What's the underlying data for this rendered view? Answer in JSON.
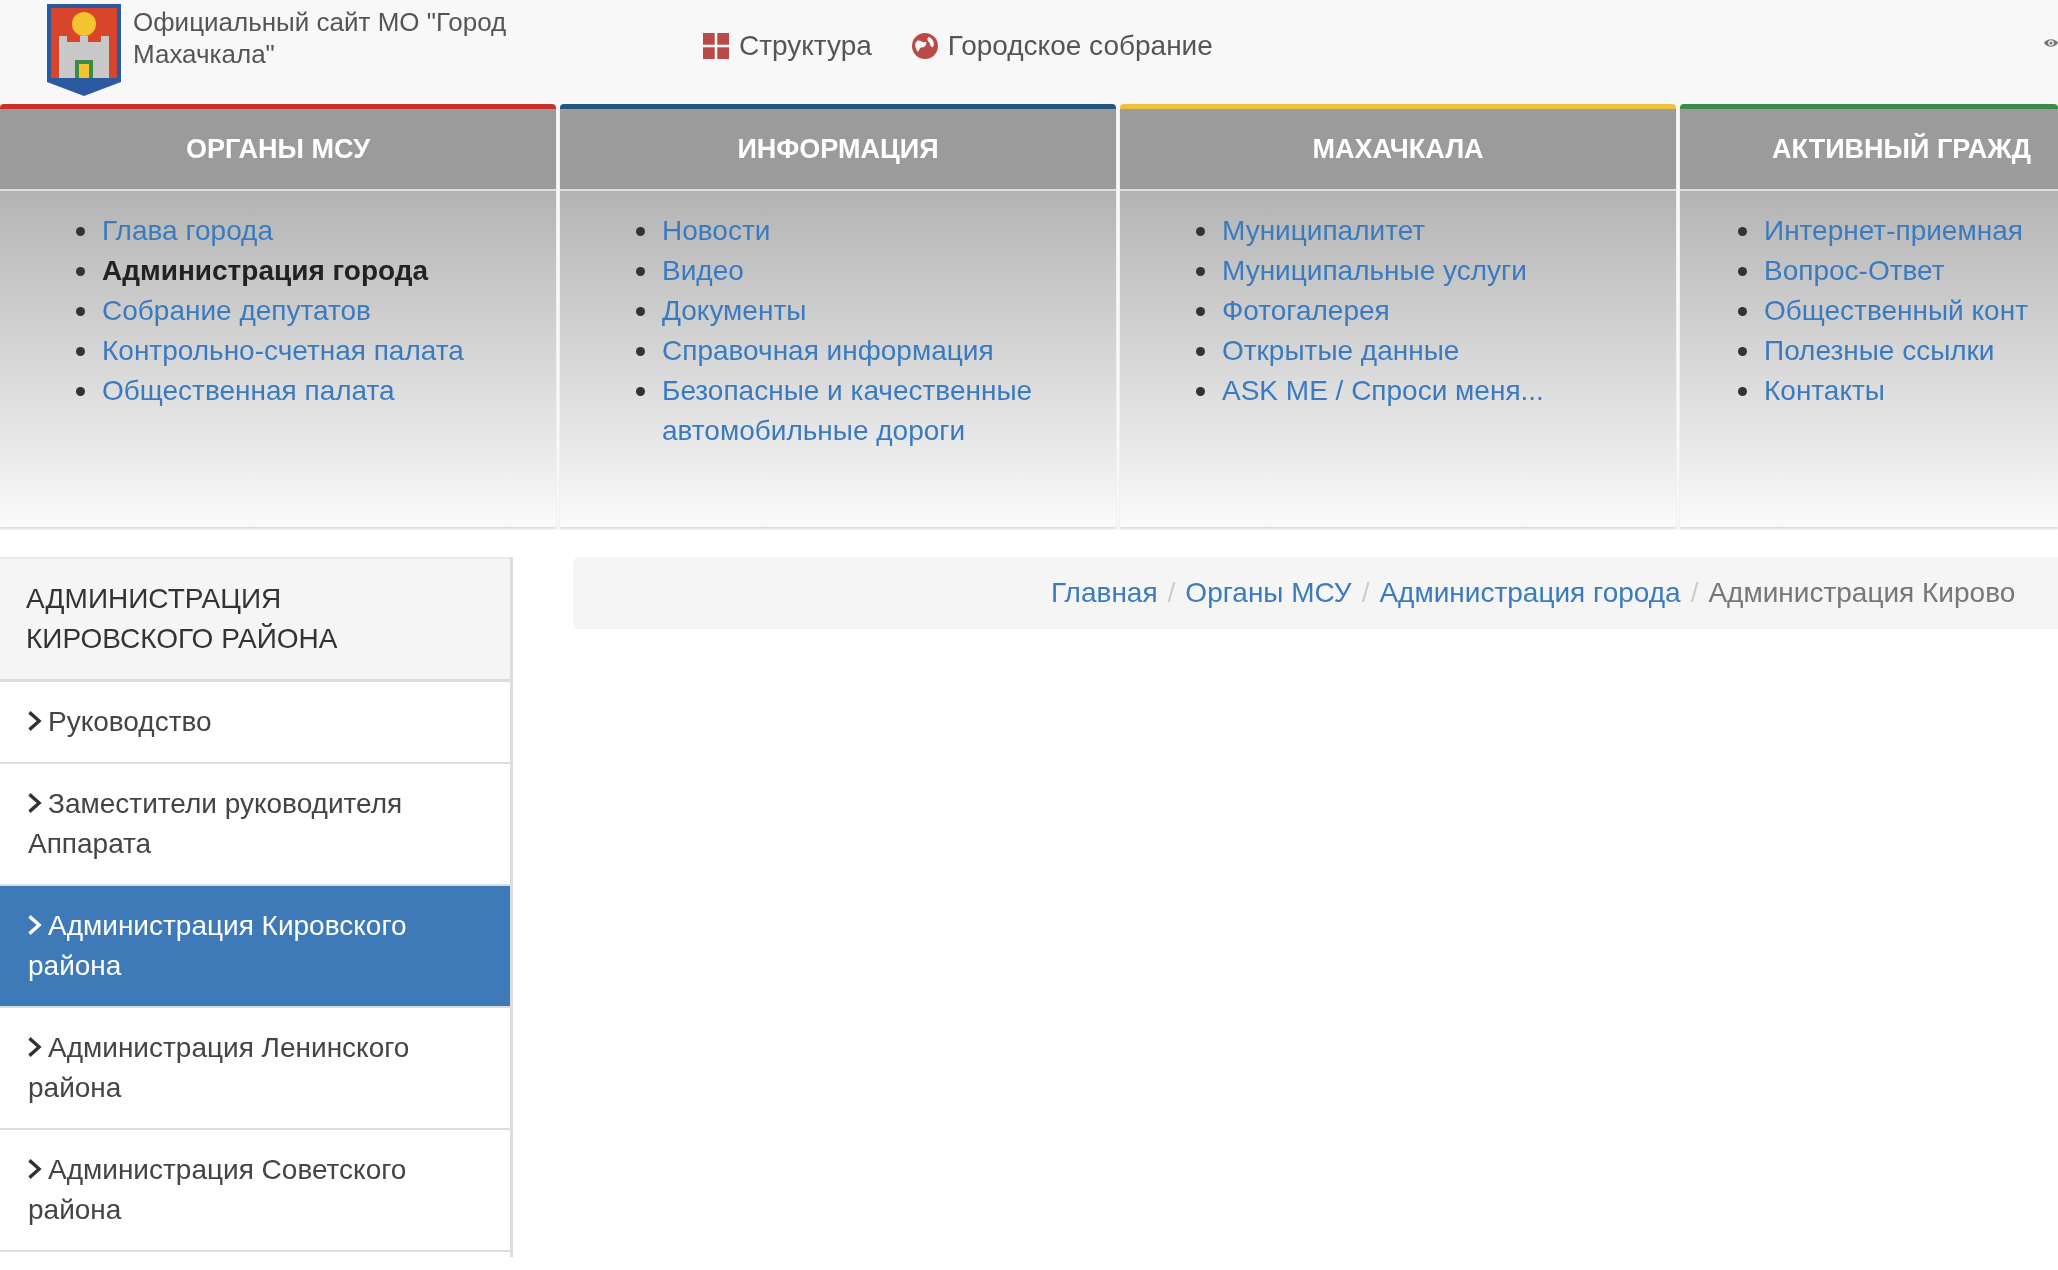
{
  "header": {
    "site_title": "Официальный сайт МО \"Город Махачкала\"",
    "nav": [
      {
        "kind": "grid",
        "label": "Структура"
      },
      {
        "kind": "globe",
        "label": "Городское собрание"
      }
    ]
  },
  "mega_menu": [
    {
      "title": "ОРГАНЫ МСУ",
      "color": "#c9302c",
      "links": [
        {
          "label": "Глава города",
          "selected": false
        },
        {
          "label": "Администрация города",
          "selected": true
        },
        {
          "label": "Собрание депутатов",
          "selected": false
        },
        {
          "label": "Контрольно-счетная палата",
          "selected": false
        },
        {
          "label": "Общественная палата",
          "selected": false
        }
      ]
    },
    {
      "title": "ИНФОРМАЦИЯ",
      "color": "#245580",
      "links": [
        {
          "label": "Новости",
          "selected": false
        },
        {
          "label": "Видео",
          "selected": false
        },
        {
          "label": "Документы",
          "selected": false
        },
        {
          "label": "Справочная информация",
          "selected": false
        },
        {
          "label": "Безопасные и качественные автомобильные дороги",
          "selected": false
        }
      ]
    },
    {
      "title": "МАХАЧКАЛА",
      "color": "#f0c23a",
      "links": [
        {
          "label": "Муниципалитет",
          "selected": false
        },
        {
          "label": "Муниципальные услуги",
          "selected": false
        },
        {
          "label": "Фотогалерея",
          "selected": false
        },
        {
          "label": "Открытые данные",
          "selected": false
        },
        {
          "label": "ASK ME / Спроси меня...",
          "selected": false
        }
      ]
    },
    {
      "title": "АКТИВНЫЙ ГРАЖД",
      "color": "#3c8a4a",
      "links": [
        {
          "label": "Интернет-приемная",
          "selected": false
        },
        {
          "label": "Вопрос-Ответ",
          "selected": false
        },
        {
          "label": "Общественный конт",
          "selected": false
        },
        {
          "label": "Полезные ссылки",
          "selected": false
        },
        {
          "label": "Контакты",
          "selected": false
        }
      ]
    }
  ],
  "sidebar": {
    "title": "АДМИНИСТРАЦИЯ КИРОВСКОГО РАЙОНА",
    "items": [
      {
        "label": "Руководство",
        "selected": false
      },
      {
        "label": "Заместители руководителя Аппарата",
        "selected": false
      },
      {
        "label": "Администрация Кировского района",
        "selected": true
      },
      {
        "label": "Администрация Ленинского района",
        "selected": false
      },
      {
        "label": "Администрация Советского района",
        "selected": false
      }
    ]
  },
  "breadcrumb": {
    "separator": "/",
    "items": [
      {
        "label": "Главная",
        "kind": "link"
      },
      {
        "label": "Органы МСУ",
        "kind": "link"
      },
      {
        "label": "Администрация города",
        "kind": "link"
      },
      {
        "label": "Администрация Кирово",
        "kind": "current"
      }
    ]
  }
}
